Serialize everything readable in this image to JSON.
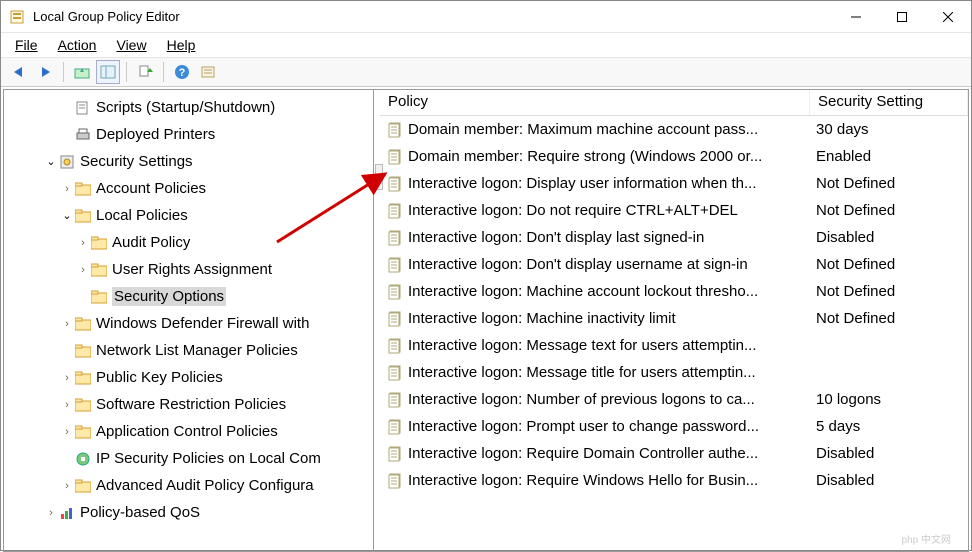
{
  "window": {
    "title": "Local Group Policy Editor"
  },
  "menu": {
    "file": "File",
    "action": "Action",
    "view": "View",
    "help": "Help"
  },
  "tree": {
    "items": [
      {
        "label": "Scripts (Startup/Shutdown)",
        "indent": 1,
        "icon": "script",
        "twisty": ""
      },
      {
        "label": "Deployed Printers",
        "indent": 1,
        "icon": "printer",
        "twisty": ""
      },
      {
        "label": "Security Settings",
        "indent": 0,
        "icon": "security",
        "twisty": "open"
      },
      {
        "label": "Account Policies",
        "indent": 1,
        "icon": "folder",
        "twisty": "closed"
      },
      {
        "label": "Local Policies",
        "indent": 1,
        "icon": "folder",
        "twisty": "open"
      },
      {
        "label": "Audit Policy",
        "indent": 2,
        "icon": "folder",
        "twisty": "closed"
      },
      {
        "label": "User Rights Assignment",
        "indent": 2,
        "icon": "folder",
        "twisty": "closed"
      },
      {
        "label": "Security Options",
        "indent": 2,
        "icon": "folder",
        "twisty": "",
        "selected": true
      },
      {
        "label": "Windows Defender Firewall with",
        "indent": 1,
        "icon": "folder",
        "twisty": "closed"
      },
      {
        "label": "Network List Manager Policies",
        "indent": 1,
        "icon": "folder",
        "twisty": ""
      },
      {
        "label": "Public Key Policies",
        "indent": 1,
        "icon": "folder",
        "twisty": "closed"
      },
      {
        "label": "Software Restriction Policies",
        "indent": 1,
        "icon": "folder",
        "twisty": "closed"
      },
      {
        "label": "Application Control Policies",
        "indent": 1,
        "icon": "folder",
        "twisty": "closed"
      },
      {
        "label": "IP Security Policies on Local Com",
        "indent": 1,
        "icon": "ipsec",
        "twisty": ""
      },
      {
        "label": "Advanced Audit Policy Configura",
        "indent": 1,
        "icon": "folder",
        "twisty": "closed"
      },
      {
        "label": "Policy-based QoS",
        "indent": 0,
        "icon": "qos",
        "twisty": "closed"
      }
    ]
  },
  "list": {
    "columns": {
      "policy": "Policy",
      "setting": "Security Setting"
    },
    "rows": [
      {
        "name": "Domain member: Maximum machine account pass...",
        "setting": "30 days"
      },
      {
        "name": "Domain member: Require strong (Windows 2000 or...",
        "setting": "Enabled"
      },
      {
        "name": "Interactive logon: Display user information when th...",
        "setting": "Not Defined"
      },
      {
        "name": "Interactive logon: Do not require CTRL+ALT+DEL",
        "setting": "Not Defined",
        "hl": true
      },
      {
        "name": "Interactive logon: Don't display last signed-in",
        "setting": "Disabled"
      },
      {
        "name": "Interactive logon: Don't display username at sign-in",
        "setting": "Not Defined"
      },
      {
        "name": "Interactive logon: Machine account lockout thresho...",
        "setting": "Not Defined"
      },
      {
        "name": "Interactive logon: Machine inactivity limit",
        "setting": "Not Defined"
      },
      {
        "name": "Interactive logon: Message text for users attemptin...",
        "setting": ""
      },
      {
        "name": "Interactive logon: Message title for users attemptin...",
        "setting": ""
      },
      {
        "name": "Interactive logon: Number of previous logons to ca...",
        "setting": "10 logons"
      },
      {
        "name": "Interactive logon: Prompt user to change password...",
        "setting": "5 days"
      },
      {
        "name": "Interactive logon: Require Domain Controller authe...",
        "setting": "Disabled"
      },
      {
        "name": "Interactive logon: Require Windows Hello for Busin...",
        "setting": "Disabled"
      }
    ]
  },
  "watermark": "php 中文网"
}
